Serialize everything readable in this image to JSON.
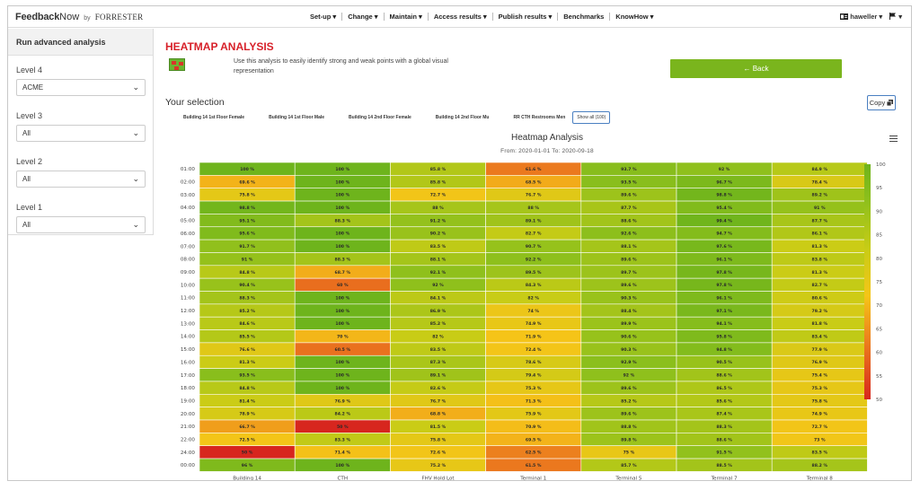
{
  "app": {
    "brand_feedback": "Feedback",
    "brand_now": "Now",
    "brand_by": "by",
    "brand_forrester": "FORRESTER"
  },
  "nav": {
    "items": [
      {
        "label": "Set-up ▾"
      },
      {
        "label": "Change ▾"
      },
      {
        "label": "Maintain ▾"
      },
      {
        "label": "Access results ▾"
      },
      {
        "label": "Publish results ▾"
      },
      {
        "label": "Benchmarks"
      },
      {
        "label": "KnowHow ▾"
      }
    ],
    "user_label": "haweller ▾",
    "flag_label": "▾"
  },
  "sidebar": {
    "title": "Run advanced analysis",
    "levels": [
      {
        "label": "Level 4",
        "value": "ACME"
      },
      {
        "label": "Level 3",
        "value": "All"
      },
      {
        "label": "Level 2",
        "value": "All"
      },
      {
        "label": "Level 1",
        "value": "All"
      }
    ]
  },
  "main": {
    "title": "HEATMAP ANALYSIS",
    "description": "Use this analysis to easily identify strong and weak points with a global visual representation",
    "back_label": "← Back",
    "your_selection": "Your selection",
    "copy_label": "Copy",
    "selections": [
      "Building 14 1st Floor Female",
      "Building 14 1st Floor Male",
      "Building 14 2nd Floor Female",
      "Building 14 2nd Floor Mu",
      "RR CTH Restrooms Men"
    ],
    "show_all": "Show all (100)"
  },
  "chart_data": {
    "type": "heatmap",
    "title": "Heatmap Analysis",
    "subtitle": "From: 2020-01-01 To: 2020-09-18",
    "x_categories": [
      "Building 14",
      "CTH",
      "FHV Hold Lot",
      "Terminal 1",
      "Terminal 5",
      "Terminal 7",
      "Terminal 8"
    ],
    "y_categories": [
      "01:00",
      "02:00",
      "03:00",
      "04:00",
      "05:00",
      "06:00",
      "07:00",
      "08:00",
      "09:00",
      "10:00",
      "11:00",
      "12:00",
      "13:00",
      "14:00",
      "15:00",
      "16:00",
      "17:00",
      "18:00",
      "19:00",
      "20:00",
      "21:00",
      "22:00",
      "24:00",
      "00:00"
    ],
    "values": [
      [
        100,
        100,
        85.8,
        61.6,
        93.7,
        92,
        84.9
      ],
      [
        69.6,
        100,
        85.8,
        68.5,
        93.5,
        96.7,
        78.4
      ],
      [
        75.8,
        100,
        72.7,
        76.7,
        89.6,
        98.8,
        89.2
      ],
      [
        98.8,
        100,
        88,
        88,
        87.7,
        95.4,
        91
      ],
      [
        95.1,
        88.3,
        91.2,
        89.1,
        88.6,
        99.4,
        87.7
      ],
      [
        95.6,
        100,
        90.2,
        82.7,
        92.6,
        94.7,
        86.1
      ],
      [
        91.7,
        100,
        83.5,
        90.7,
        88.1,
        97.6,
        81.3
      ],
      [
        91,
        88.3,
        88.1,
        92.2,
        89.6,
        96.1,
        83.8
      ],
      [
        84.8,
        68.7,
        92.1,
        89.5,
        89.7,
        97.8,
        81.3
      ],
      [
        90.4,
        60,
        92,
        84.3,
        89.6,
        97.8,
        82.7
      ],
      [
        88.3,
        100,
        84.1,
        82,
        90.3,
        96.1,
        80.6
      ],
      [
        85.2,
        100,
        86.9,
        74,
        88.4,
        97.1,
        79.2
      ],
      [
        84.6,
        100,
        85.2,
        74.9,
        89.9,
        94.1,
        81.8
      ],
      [
        85.5,
        70,
        82,
        71.9,
        90.6,
        95.8,
        83.4
      ],
      [
        76.6,
        60.5,
        83.5,
        72.4,
        90.3,
        94.8,
        77.9
      ],
      [
        81.3,
        100,
        87.3,
        78.6,
        92.9,
        90.5,
        76.9
      ],
      [
        93.5,
        100,
        89.1,
        79.4,
        92,
        88.6,
        75.4
      ],
      [
        84.8,
        100,
        82.6,
        75.3,
        89.6,
        86.5,
        75.3
      ],
      [
        81.4,
        76.9,
        76.7,
        71.3,
        85.2,
        85.6,
        75.8
      ],
      [
        78.9,
        84.2,
        68.8,
        75.9,
        89.6,
        87.4,
        74.9
      ],
      [
        66.7,
        50,
        81.5,
        70.9,
        88.8,
        88.3,
        72.7
      ],
      [
        72.5,
        83.3,
        75.8,
        69.5,
        89.8,
        88.6,
        73
      ],
      [
        50,
        71.4,
        72.6,
        62.5,
        75,
        91.5,
        83.5
      ],
      [
        96,
        100,
        75.2,
        61.5,
        85.7,
        88.5,
        88.2
      ]
    ],
    "value_labels": [
      [
        "100 %",
        "100 %",
        "85.8 %",
        "61.6 %",
        "93.7 %",
        "92 %",
        "84.9 %"
      ],
      [
        "69.6 %",
        "100 %",
        "85.8 %",
        "68.5 %",
        "93.5 %",
        "96.7 %",
        "78.4 %"
      ],
      [
        "75.8 %",
        "100 %",
        "72.7 %",
        "76.7 %",
        "89.6 %",
        "98.8 %",
        "89.2 %"
      ],
      [
        "98.8 %",
        "100 %",
        "88 %",
        "88 %",
        "87.7 %",
        "95.4 %",
        "91 %"
      ],
      [
        "95.1 %",
        "88.3 %",
        "91.2 %",
        "89.1 %",
        "88.6 %",
        "99.4 %",
        "87.7 %"
      ],
      [
        "95.6 %",
        "100 %",
        "90.2 %",
        "82.7 %",
        "92.6 %",
        "94.7 %",
        "86.1 %"
      ],
      [
        "91.7 %",
        "100 %",
        "83.5 %",
        "90.7 %",
        "88.1 %",
        "97.6 %",
        "81.3 %"
      ],
      [
        "91 %",
        "88.3 %",
        "88.1 %",
        "92.2 %",
        "89.6 %",
        "96.1 %",
        "83.8 %"
      ],
      [
        "84.8 %",
        "68.7 %",
        "92.1 %",
        "89.5 %",
        "89.7 %",
        "97.8 %",
        "81.3 %"
      ],
      [
        "90.4 %",
        "60 %",
        "92 %",
        "84.3 %",
        "89.6 %",
        "97.8 %",
        "82.7 %"
      ],
      [
        "88.3 %",
        "100 %",
        "84.1 %",
        "82 %",
        "90.3 %",
        "96.1 %",
        "80.6 %"
      ],
      [
        "85.2 %",
        "100 %",
        "86.9 %",
        "74 %",
        "88.4 %",
        "97.1 %",
        "79.2 %"
      ],
      [
        "84.6 %",
        "100 %",
        "85.2 %",
        "74.9 %",
        "89.9 %",
        "94.1 %",
        "81.8 %"
      ],
      [
        "85.5 %",
        "70 %",
        "82 %",
        "71.9 %",
        "90.6 %",
        "95.8 %",
        "83.4 %"
      ],
      [
        "76.6 %",
        "60.5 %",
        "83.5 %",
        "72.4 %",
        "90.3 %",
        "94.8 %",
        "77.9 %"
      ],
      [
        "81.3 %",
        "100 %",
        "87.3 %",
        "78.6 %",
        "92.9 %",
        "90.5 %",
        "76.9 %"
      ],
      [
        "93.5 %",
        "100 %",
        "89.1 %",
        "79.4 %",
        "92 %",
        "88.6 %",
        "75.4 %"
      ],
      [
        "84.8 %",
        "100 %",
        "82.6 %",
        "75.3 %",
        "89.6 %",
        "86.5 %",
        "75.3 %"
      ],
      [
        "81.4 %",
        "76.9 %",
        "76.7 %",
        "71.3 %",
        "85.2 %",
        "85.6 %",
        "75.8 %"
      ],
      [
        "78.9 %",
        "84.2 %",
        "68.8 %",
        "75.9 %",
        "89.6 %",
        "87.4 %",
        "74.9 %"
      ],
      [
        "66.7 %",
        "50 %",
        "81.5 %",
        "70.9 %",
        "88.8 %",
        "88.3 %",
        "72.7 %"
      ],
      [
        "72.5 %",
        "83.3 %",
        "75.8 %",
        "69.5 %",
        "89.8 %",
        "88.6 %",
        "73 %"
      ],
      [
        "50 %",
        "71.4 %",
        "72.6 %",
        "62.5 %",
        "75 %",
        "91.5 %",
        "83.5 %"
      ],
      [
        "96 %",
        "100 %",
        "75.2 %",
        "61.5 %",
        "85.7 %",
        "88.5 %",
        "88.2 %"
      ]
    ],
    "color_scale": {
      "min": 50,
      "max": 100,
      "ticks": [
        "100",
        "95",
        "90",
        "85",
        "80",
        "75",
        "70",
        "65",
        "60",
        "55",
        "50"
      ],
      "stops": [
        {
          "value": 50,
          "color": "#d7261e"
        },
        {
          "value": 62,
          "color": "#ec7c1e"
        },
        {
          "value": 72,
          "color": "#f5c518"
        },
        {
          "value": 82,
          "color": "#c8cc16"
        },
        {
          "value": 92,
          "color": "#8fc01c"
        },
        {
          "value": 100,
          "color": "#6eb41c"
        }
      ]
    },
    "grid": false,
    "legend": "right"
  }
}
